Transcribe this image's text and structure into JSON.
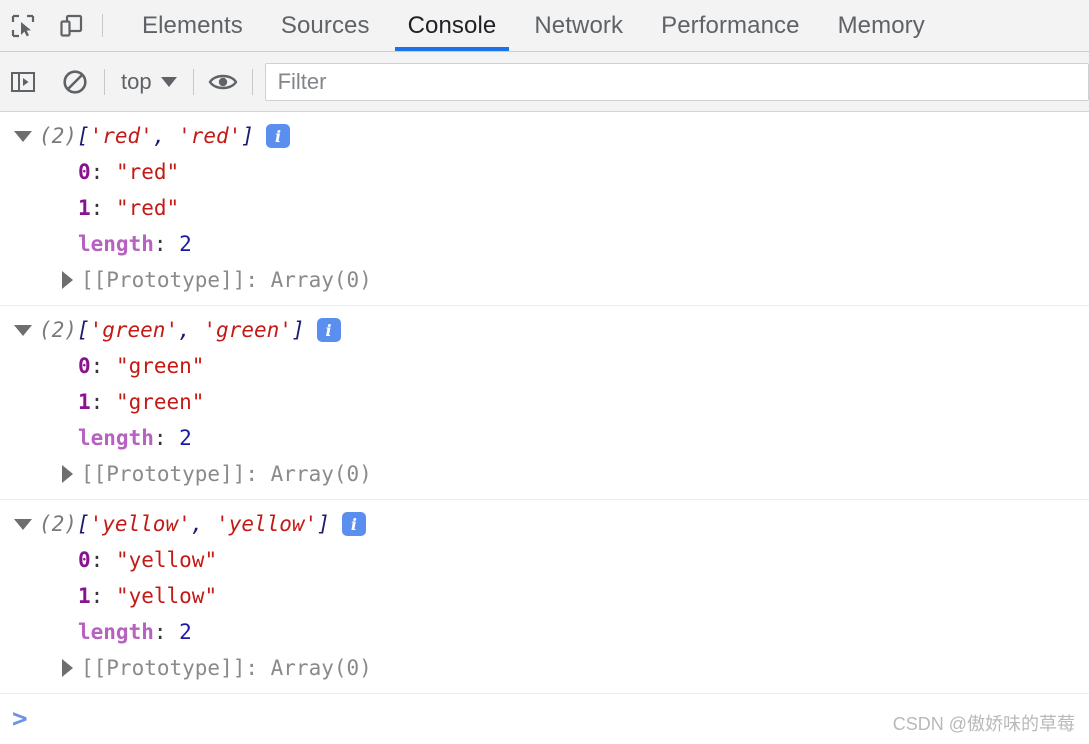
{
  "toolbar_icons": {
    "inspect": "inspect-element-icon",
    "device": "device-toolbar-icon"
  },
  "tabs": [
    {
      "label": "Elements",
      "active": false
    },
    {
      "label": "Sources",
      "active": false
    },
    {
      "label": "Console",
      "active": true
    },
    {
      "label": "Network",
      "active": false
    },
    {
      "label": "Performance",
      "active": false
    },
    {
      "label": "Memory",
      "active": false
    }
  ],
  "console_toolbar": {
    "sidebar_toggle": "show-console-sidebar-icon",
    "clear_console": "clear-console-icon",
    "context_value": "top",
    "eye_icon": "live-expression-eye-icon",
    "filter_placeholder": "Filter"
  },
  "messages": [
    {
      "preview": {
        "count": "(2)",
        "open": "[",
        "items": [
          "'red'",
          "'red'"
        ],
        "separator": ", ",
        "close": "]"
      },
      "props": [
        {
          "key": "0",
          "colon": ": ",
          "value": "\"red\"",
          "type": "string"
        },
        {
          "key": "1",
          "colon": ": ",
          "value": "\"red\"",
          "type": "string"
        },
        {
          "key": "length",
          "colon": ": ",
          "value": "2",
          "type": "number"
        }
      ],
      "prototype": "[[Prototype]]: Array(0)"
    },
    {
      "preview": {
        "count": "(2)",
        "open": "[",
        "items": [
          "'green'",
          "'green'"
        ],
        "separator": ", ",
        "close": "]"
      },
      "props": [
        {
          "key": "0",
          "colon": ": ",
          "value": "\"green\"",
          "type": "string"
        },
        {
          "key": "1",
          "colon": ": ",
          "value": "\"green\"",
          "type": "string"
        },
        {
          "key": "length",
          "colon": ": ",
          "value": "2",
          "type": "number"
        }
      ],
      "prototype": "[[Prototype]]: Array(0)"
    },
    {
      "preview": {
        "count": "(2)",
        "open": "[",
        "items": [
          "'yellow'",
          "'yellow'"
        ],
        "separator": ", ",
        "close": "]"
      },
      "props": [
        {
          "key": "0",
          "colon": ": ",
          "value": "\"yellow\"",
          "type": "string"
        },
        {
          "key": "1",
          "colon": ": ",
          "value": "\"yellow\"",
          "type": "string"
        },
        {
          "key": "length",
          "colon": ": ",
          "value": "2",
          "type": "number"
        }
      ],
      "prototype": "[[Prototype]]: Array(0)"
    }
  ],
  "info_badge_label": "i",
  "prompt": {
    "chevron": ">",
    "value": ""
  },
  "watermark": "CSDN @傲娇味的草莓",
  "colors": {
    "accent": "#1a73e8",
    "info_badge": "#5a8ff0",
    "string": "#c41a16",
    "number": "#1a1aa6",
    "key": "#881391",
    "length_key": "#b762c1",
    "prototype": "#8a8a8a",
    "prompt": "#6b93e8"
  }
}
